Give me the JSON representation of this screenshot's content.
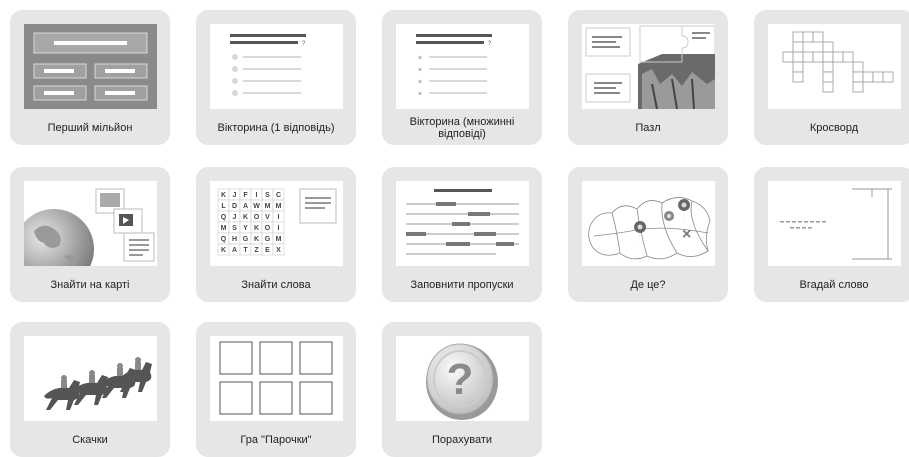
{
  "tiles": [
    {
      "label": "Перший мільйон"
    },
    {
      "label": "Вікторина (1 відповідь)"
    },
    {
      "label": "Вікторина (множинні відповіді)"
    },
    {
      "label": "Пазл"
    },
    {
      "label": "Кросворд"
    },
    {
      "label": "Знайти на карті"
    },
    {
      "label": "Знайти слова"
    },
    {
      "label": "Заповнити пропуски"
    },
    {
      "label": "Де це?"
    },
    {
      "label": "Вгадай слово"
    },
    {
      "label": "Скачки"
    },
    {
      "label": "Гра \"Парочки\""
    },
    {
      "label": "Порахувати"
    }
  ],
  "wordsearch_grid": [
    [
      "K",
      "J",
      "F",
      "I",
      "S",
      "C"
    ],
    [
      "L",
      "D",
      "A",
      "W",
      "M",
      "M"
    ],
    [
      "Q",
      "J",
      "K",
      "O",
      "V",
      "I"
    ],
    [
      "M",
      "S",
      "Y",
      "K",
      "O",
      "I"
    ],
    [
      "Q",
      "H",
      "G",
      "K",
      "G",
      "M"
    ],
    [
      "K",
      "A",
      "T",
      "Z",
      "E",
      "X"
    ]
  ],
  "counting_glyph": "?"
}
